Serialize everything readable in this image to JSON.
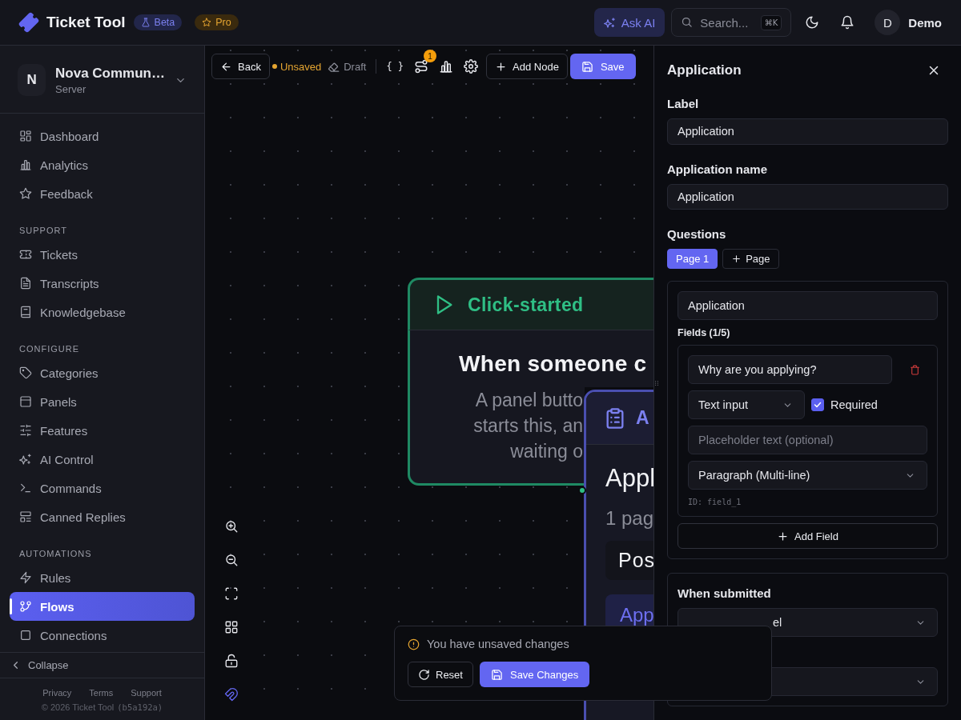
{
  "header": {
    "app_name": "Ticket Tool",
    "badges": [
      {
        "label": "Beta",
        "kind": "beta"
      },
      {
        "label": "Pro",
        "kind": "pro"
      }
    ],
    "ask_ai": "Ask AI",
    "search": {
      "placeholder": "Search...",
      "shortcut": "⌘K"
    },
    "user": {
      "initial": "D",
      "name": "Demo"
    }
  },
  "sidebar": {
    "workspace": {
      "initial": "N",
      "name": "Nova Commun…",
      "subtitle": "Server"
    },
    "sections": [
      {
        "items": [
          {
            "label": "Dashboard",
            "selected": false
          },
          {
            "label": "Analytics",
            "selected": false
          },
          {
            "label": "Feedback",
            "selected": false
          }
        ]
      },
      {
        "title": "SUPPORT",
        "items": [
          {
            "label": "Tickets",
            "selected": false
          },
          {
            "label": "Transcripts",
            "selected": false
          },
          {
            "label": "Knowledgebase",
            "selected": false
          }
        ]
      },
      {
        "title": "CONFIGURE",
        "items": [
          {
            "label": "Categories",
            "selected": false
          },
          {
            "label": "Panels",
            "selected": false
          },
          {
            "label": "Features",
            "selected": false
          },
          {
            "label": "AI Control",
            "selected": false
          },
          {
            "label": "Commands",
            "selected": false
          },
          {
            "label": "Canned Replies",
            "selected": false
          }
        ]
      },
      {
        "title": "AUTOMATIONS",
        "items": [
          {
            "label": "Rules",
            "selected": false
          },
          {
            "label": "Flows",
            "selected": true
          },
          {
            "label": "Connections",
            "selected": false
          }
        ]
      }
    ],
    "collapse": "Collapse",
    "footer_links": [
      "Privacy",
      "Terms",
      "Support"
    ],
    "copyright": "© 2026 Ticket Tool",
    "build": "(b5a192a)"
  },
  "toolbar": {
    "back": "Back",
    "status": {
      "label": "Unsaved",
      "saved": false
    },
    "mode": "Draft",
    "variables": "{ }",
    "flow_badge": "1",
    "add_node": "Add Node",
    "save": "Save"
  },
  "canvas": {
    "snap_enabled": true,
    "nodes": [
      {
        "kind": "trigger",
        "title": "Click-started",
        "heading": "When someone c",
        "description_lines": [
          "A panel butto",
          "starts this, an",
          "waiting o"
        ]
      },
      {
        "kind": "form",
        "title": "A",
        "heading": "Appl",
        "meta": "1 pag",
        "item": "Pos",
        "button": "App"
      }
    ]
  },
  "panel": {
    "title": "Application",
    "fields": [
      {
        "label": "Label",
        "value": "Application"
      },
      {
        "label": "Application name",
        "value": "Application"
      }
    ],
    "questions_label": "Questions",
    "pages": [
      {
        "label": "Page 1",
        "selected": true
      }
    ],
    "add_page": "Page",
    "page_title": "Application",
    "fields_count": "Fields (1/5)",
    "question": {
      "text": "Why are you applying?",
      "type": "Text input",
      "required": true,
      "required_label": "Required",
      "placeholder": "Placeholder text (optional)",
      "style": "Paragraph (Multi-line)",
      "id": "ID: field_1"
    },
    "add_field": "Add Field",
    "submit": {
      "title": "When submitted",
      "action_value": "el"
    }
  },
  "toast": {
    "message": "You have unsaved changes",
    "reset": "Reset",
    "save": "Save Changes"
  }
}
